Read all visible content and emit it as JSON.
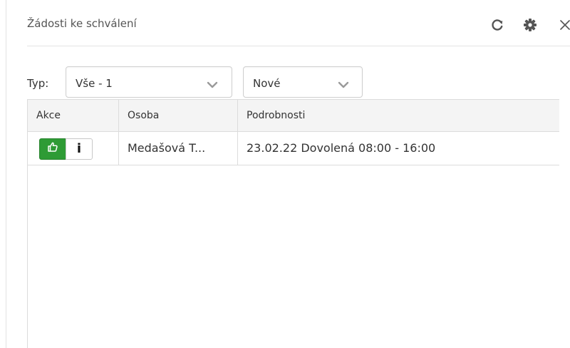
{
  "header": {
    "title": "Žádosti ke schválení",
    "icons": [
      "refresh-icon",
      "gear-icon",
      "close-icon"
    ]
  },
  "filters": {
    "type_label": "Typ:",
    "type_value": "Vše - 1",
    "status_value": "Nové"
  },
  "table": {
    "columns": [
      "Akce",
      "Osoba",
      "Podrobnosti"
    ],
    "rows": [
      {
        "actions": [
          "approve",
          "info"
        ],
        "info_label": "i",
        "person": "Medašová T...",
        "details": "23.02.22 Dovolená 08:00 - 16:00"
      }
    ]
  },
  "colors": {
    "approve": "#2e9b35",
    "header_bg": "#f4f4f4",
    "border": "#dcdcdc",
    "icon": "#555555"
  }
}
